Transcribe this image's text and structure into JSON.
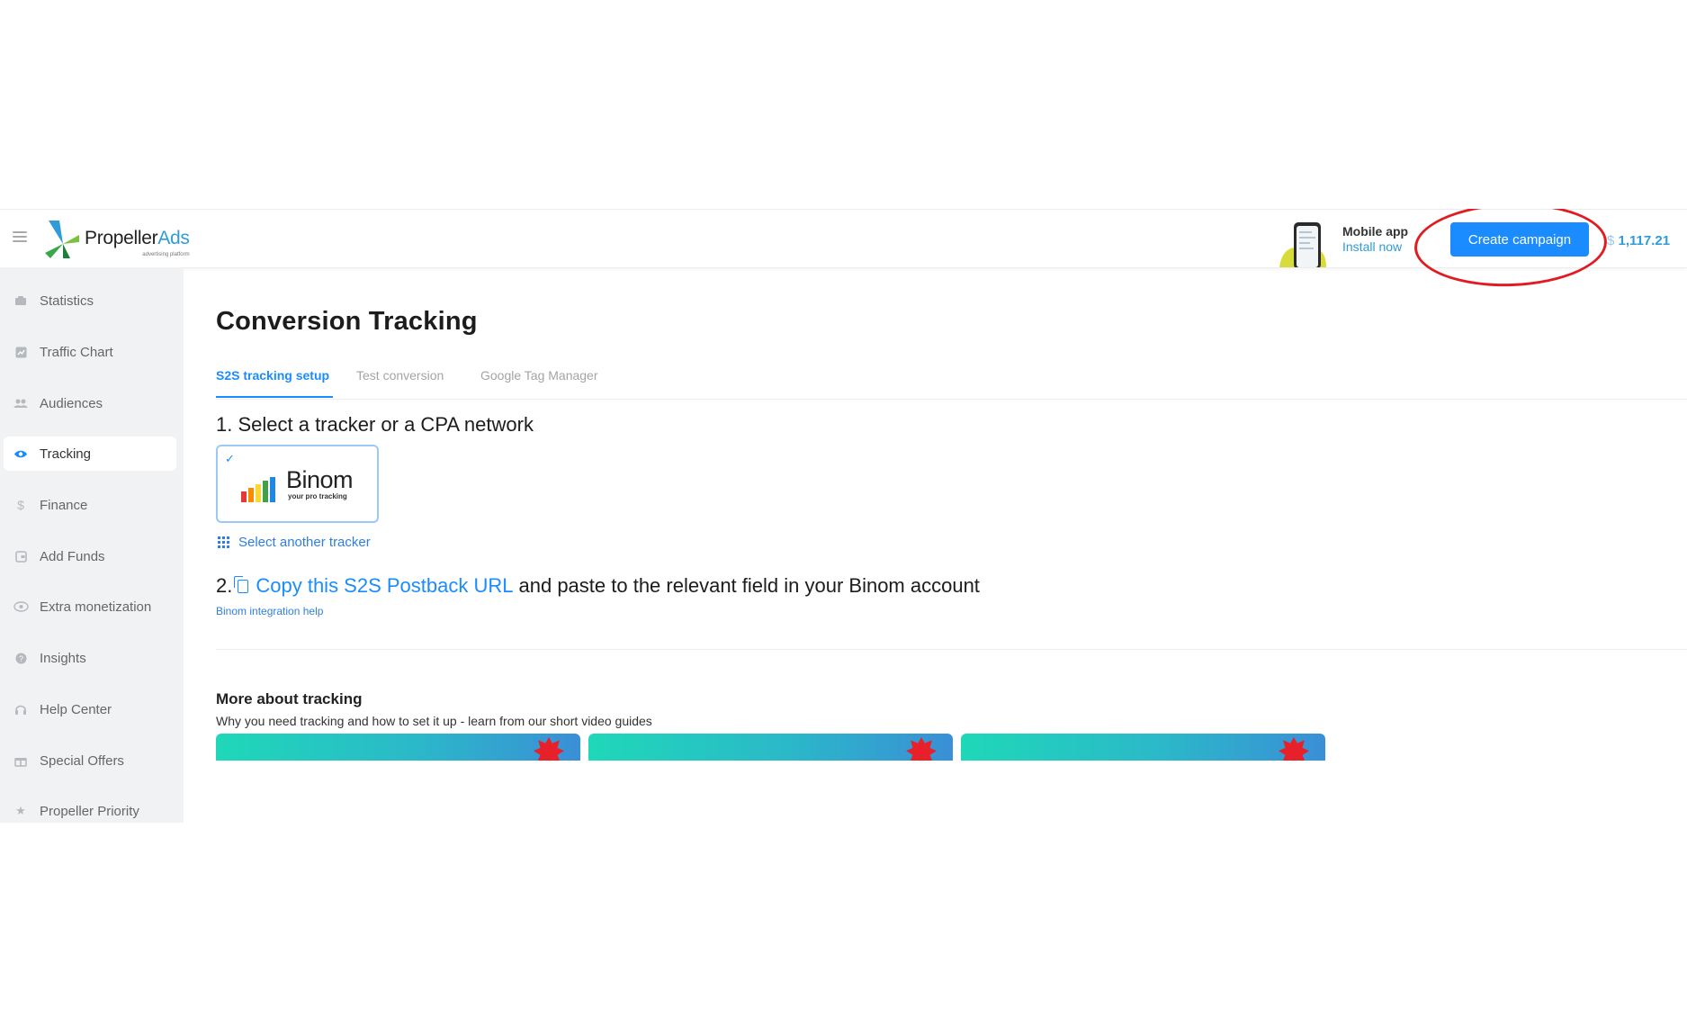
{
  "header": {
    "menu_icon": "hamburger-icon",
    "logo_text_main": "Propeller",
    "logo_text_accent": "Ads",
    "logo_tagline": "advertising platform",
    "mobile_app_title": "Mobile app",
    "mobile_app_link": "Install now",
    "create_campaign_label": "Create campaign",
    "balance_currency": "$",
    "balance_amount": "1,117.21"
  },
  "sidebar": {
    "items": [
      {
        "label": "Statistics",
        "icon": "chart-icon",
        "active": false
      },
      {
        "label": "Traffic Chart",
        "icon": "traffic-chart-icon",
        "active": false
      },
      {
        "label": "Audiences",
        "icon": "users-icon",
        "active": false
      },
      {
        "label": "Tracking",
        "icon": "eye-icon",
        "active": true
      },
      {
        "label": "Finance",
        "icon": "dollar-icon",
        "active": false
      },
      {
        "label": "Add Funds",
        "icon": "wallet-icon",
        "active": false
      },
      {
        "label": "Extra monetization",
        "icon": "coins-icon",
        "active": false
      },
      {
        "label": "Insights",
        "icon": "question-icon",
        "active": false
      },
      {
        "label": "Help Center",
        "icon": "headset-icon",
        "active": false
      },
      {
        "label": "Special Offers",
        "icon": "gift-icon",
        "active": false
      },
      {
        "label": "Propeller Priority",
        "icon": "star-icon",
        "active": false
      }
    ]
  },
  "main": {
    "title": "Conversion Tracking",
    "tabs": [
      {
        "label": "S2S tracking setup",
        "active": true
      },
      {
        "label": "Test conversion",
        "active": false
      },
      {
        "label": "Google Tag Manager",
        "active": false
      }
    ],
    "step1_title": "1. Select a tracker or a CPA network",
    "tracker": {
      "name": "Binom",
      "tagline": "your pro tracking",
      "selected": true
    },
    "select_another_label": "Select another tracker",
    "step2_prefix": "2.",
    "step2_link": "Copy this S2S Postback URL",
    "step2_suffix": "and paste to the relevant field in your Binom account",
    "integration_help_label": "Binom integration help",
    "more_title": "More about tracking",
    "more_subtitle": "Why you need tracking and how to set it up - learn from our short video guides"
  },
  "colors": {
    "accent": "#1a8cff",
    "link": "#2f7fe0",
    "annotation": "#e21b23",
    "sidebar_bg": "#f1f2f4"
  }
}
